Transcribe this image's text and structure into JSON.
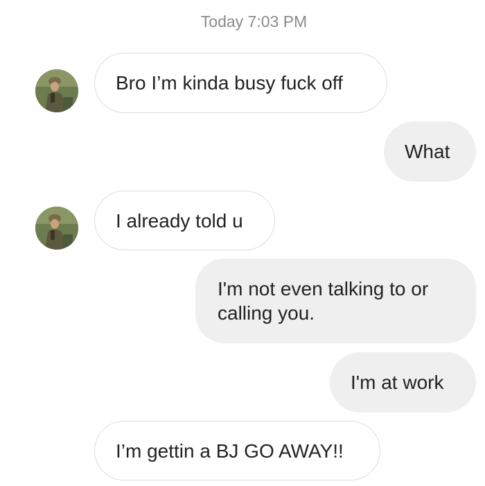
{
  "conversation": {
    "timestamp": "Today 7:03 PM",
    "messages": [
      {
        "direction": "incoming",
        "text": "Bro I’m kinda busy fuck off",
        "show_avatar": true
      },
      {
        "direction": "outgoing",
        "text": "What"
      },
      {
        "direction": "incoming",
        "text": "I already told u",
        "show_avatar": true
      },
      {
        "direction": "outgoing",
        "text": "I'm not even talking to or calling you."
      },
      {
        "direction": "outgoing",
        "text": "I'm at work"
      },
      {
        "direction": "incoming",
        "text": "I’m gettin a BJ GO AWAY!!",
        "show_avatar": false
      }
    ]
  },
  "colors": {
    "incoming_bubble_bg": "#ffffff",
    "incoming_bubble_border": "#dcdcdc",
    "outgoing_bubble_bg": "#efefef",
    "timestamp_text": "#8a8a8a",
    "message_text": "#222222"
  },
  "icons": {
    "avatar": "profile-photo-soldier"
  }
}
